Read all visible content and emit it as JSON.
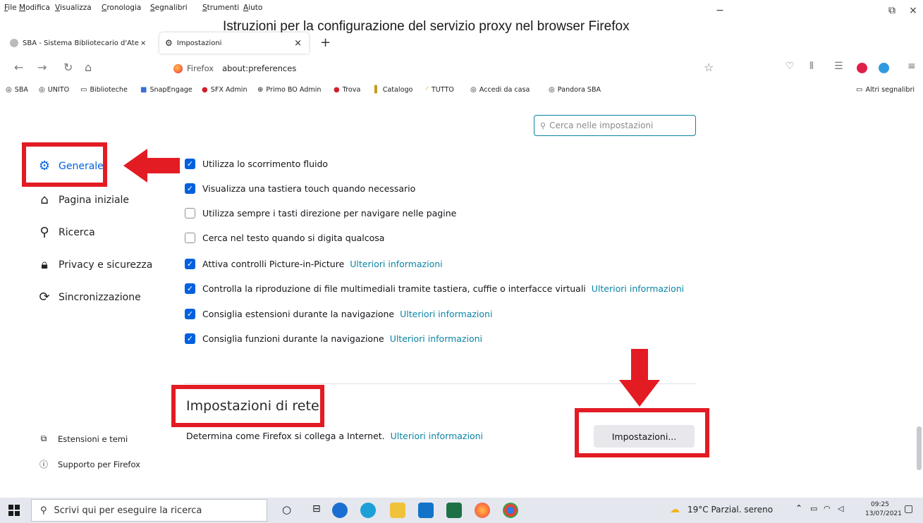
{
  "caption": "Istruzioni per la configurazione del servizio proxy nel browser Firefox",
  "menubar": {
    "items": [
      "File",
      "Modifica",
      "Visualizza",
      "Cronologia",
      "Segnalibri",
      "Strumenti",
      "Aiuto"
    ]
  },
  "tabs": [
    {
      "label": "SBA - Sistema Bibliotecario d'Ate",
      "close": "×"
    },
    {
      "label": "Impostazioni",
      "close": "×"
    }
  ],
  "new_tab": "+",
  "window_controls": {
    "minimize": "−",
    "restore": "⧉",
    "close": "×"
  },
  "urlbar": {
    "identity": "Firefox",
    "url": "about:preferences"
  },
  "bookmarks": {
    "items": [
      "SBA",
      "UNITO",
      "Biblioteche",
      "SnapEngage",
      "SFX Admin",
      "Primo BO Admin",
      "Trova",
      "Catalogo",
      "TUTTO",
      "Accedi da casa",
      "Pandora SBA"
    ],
    "other": "Altri segnalibri"
  },
  "search": {
    "placeholder": "Cerca nelle impostazioni"
  },
  "sidebar": {
    "items": [
      {
        "label": "Generale",
        "icon": "gear-icon"
      },
      {
        "label": "Pagina iniziale",
        "icon": "home-icon"
      },
      {
        "label": "Ricerca",
        "icon": "search-icon"
      },
      {
        "label": "Privacy e sicurezza",
        "icon": "lock-icon"
      },
      {
        "label": "Sincronizzazione",
        "icon": "sync-icon"
      }
    ],
    "footer": [
      {
        "label": "Estensioni e temi",
        "icon": "puzzle-icon"
      },
      {
        "label": "Supporto per Firefox",
        "icon": "help-icon"
      }
    ]
  },
  "settings": [
    {
      "label": "Utilizza lo scorrimento fluido",
      "checked": true,
      "link": ""
    },
    {
      "label": "Visualizza una tastiera touch quando necessario",
      "checked": true,
      "link": ""
    },
    {
      "label": "Utilizza sempre i tasti direzione per navigare nelle pagine",
      "checked": false,
      "link": ""
    },
    {
      "label": "Cerca nel testo quando si digita qualcosa",
      "checked": false,
      "link": ""
    },
    {
      "label": "Attiva controlli Picture-in-Picture",
      "checked": true,
      "link": "Ulteriori informazioni"
    },
    {
      "label": "Controlla la riproduzione di file multimediali tramite tastiera, cuffie o interfacce virtuali",
      "checked": true,
      "link": "Ulteriori informazioni"
    },
    {
      "label": "Consiglia estensioni durante la navigazione",
      "checked": true,
      "link": "Ulteriori informazioni"
    },
    {
      "label": "Consiglia funzioni durante la navigazione",
      "checked": true,
      "link": "Ulteriori informazioni"
    }
  ],
  "network": {
    "heading": "Impostazioni di rete",
    "description": "Determina come Firefox si collega a Internet.",
    "link": "Ulteriori informazioni",
    "button": "Impostazioni..."
  },
  "taskbar": {
    "search_placeholder": "Scrivi qui per eseguire la ricerca",
    "weather": "19°C  Parzial. sereno",
    "time": "09:25",
    "date": "13/07/2021"
  },
  "colors": {
    "highlight": "#e31b23",
    "accent": "#0060df",
    "link": "#0a84a5"
  }
}
